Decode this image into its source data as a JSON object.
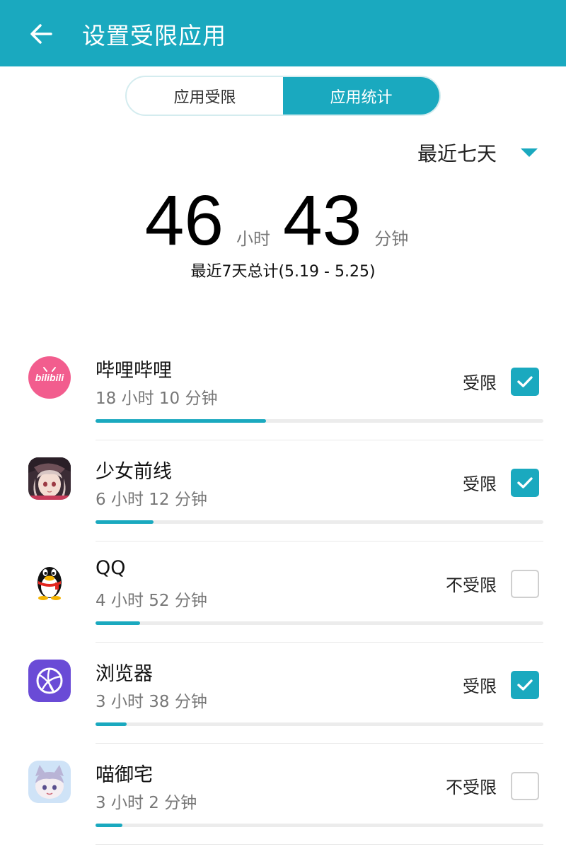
{
  "header": {
    "title": "设置受限应用"
  },
  "tabs": [
    {
      "label": "应用受限",
      "active": false
    },
    {
      "label": "应用统计",
      "active": true
    }
  ],
  "range": {
    "selected": "最近七天"
  },
  "total": {
    "hours": "46",
    "hours_unit": "小时",
    "minutes": "43",
    "minutes_unit": "分钟",
    "subtitle": "最近7天总计(5.19 - 5.25)"
  },
  "apps": [
    {
      "name": "哔哩哔哩",
      "time": "18 小时 10 分钟",
      "status": "受限",
      "checked": true,
      "usage_fraction": 0.38,
      "icon": "bilibili-icon"
    },
    {
      "name": "少女前线",
      "time": "6 小时 12 分钟",
      "status": "受限",
      "checked": true,
      "usage_fraction": 0.13,
      "icon": "girls-frontline-icon"
    },
    {
      "name": "QQ",
      "time": "4 小时 52 分钟",
      "status": "不受限",
      "checked": false,
      "usage_fraction": 0.1,
      "icon": "qq-penguin-icon"
    },
    {
      "name": "浏览器",
      "time": "3 小时 38 分钟",
      "status": "受限",
      "checked": true,
      "usage_fraction": 0.07,
      "icon": "browser-globe-icon"
    },
    {
      "name": "喵御宅",
      "time": "3 小时 2 分钟",
      "status": "不受限",
      "checked": false,
      "usage_fraction": 0.06,
      "icon": "miaoyuzhai-icon"
    }
  ],
  "colors": {
    "accent": "#1aa9bf",
    "bilibili": "#f25d8e",
    "browser": "#6a4bd6"
  }
}
